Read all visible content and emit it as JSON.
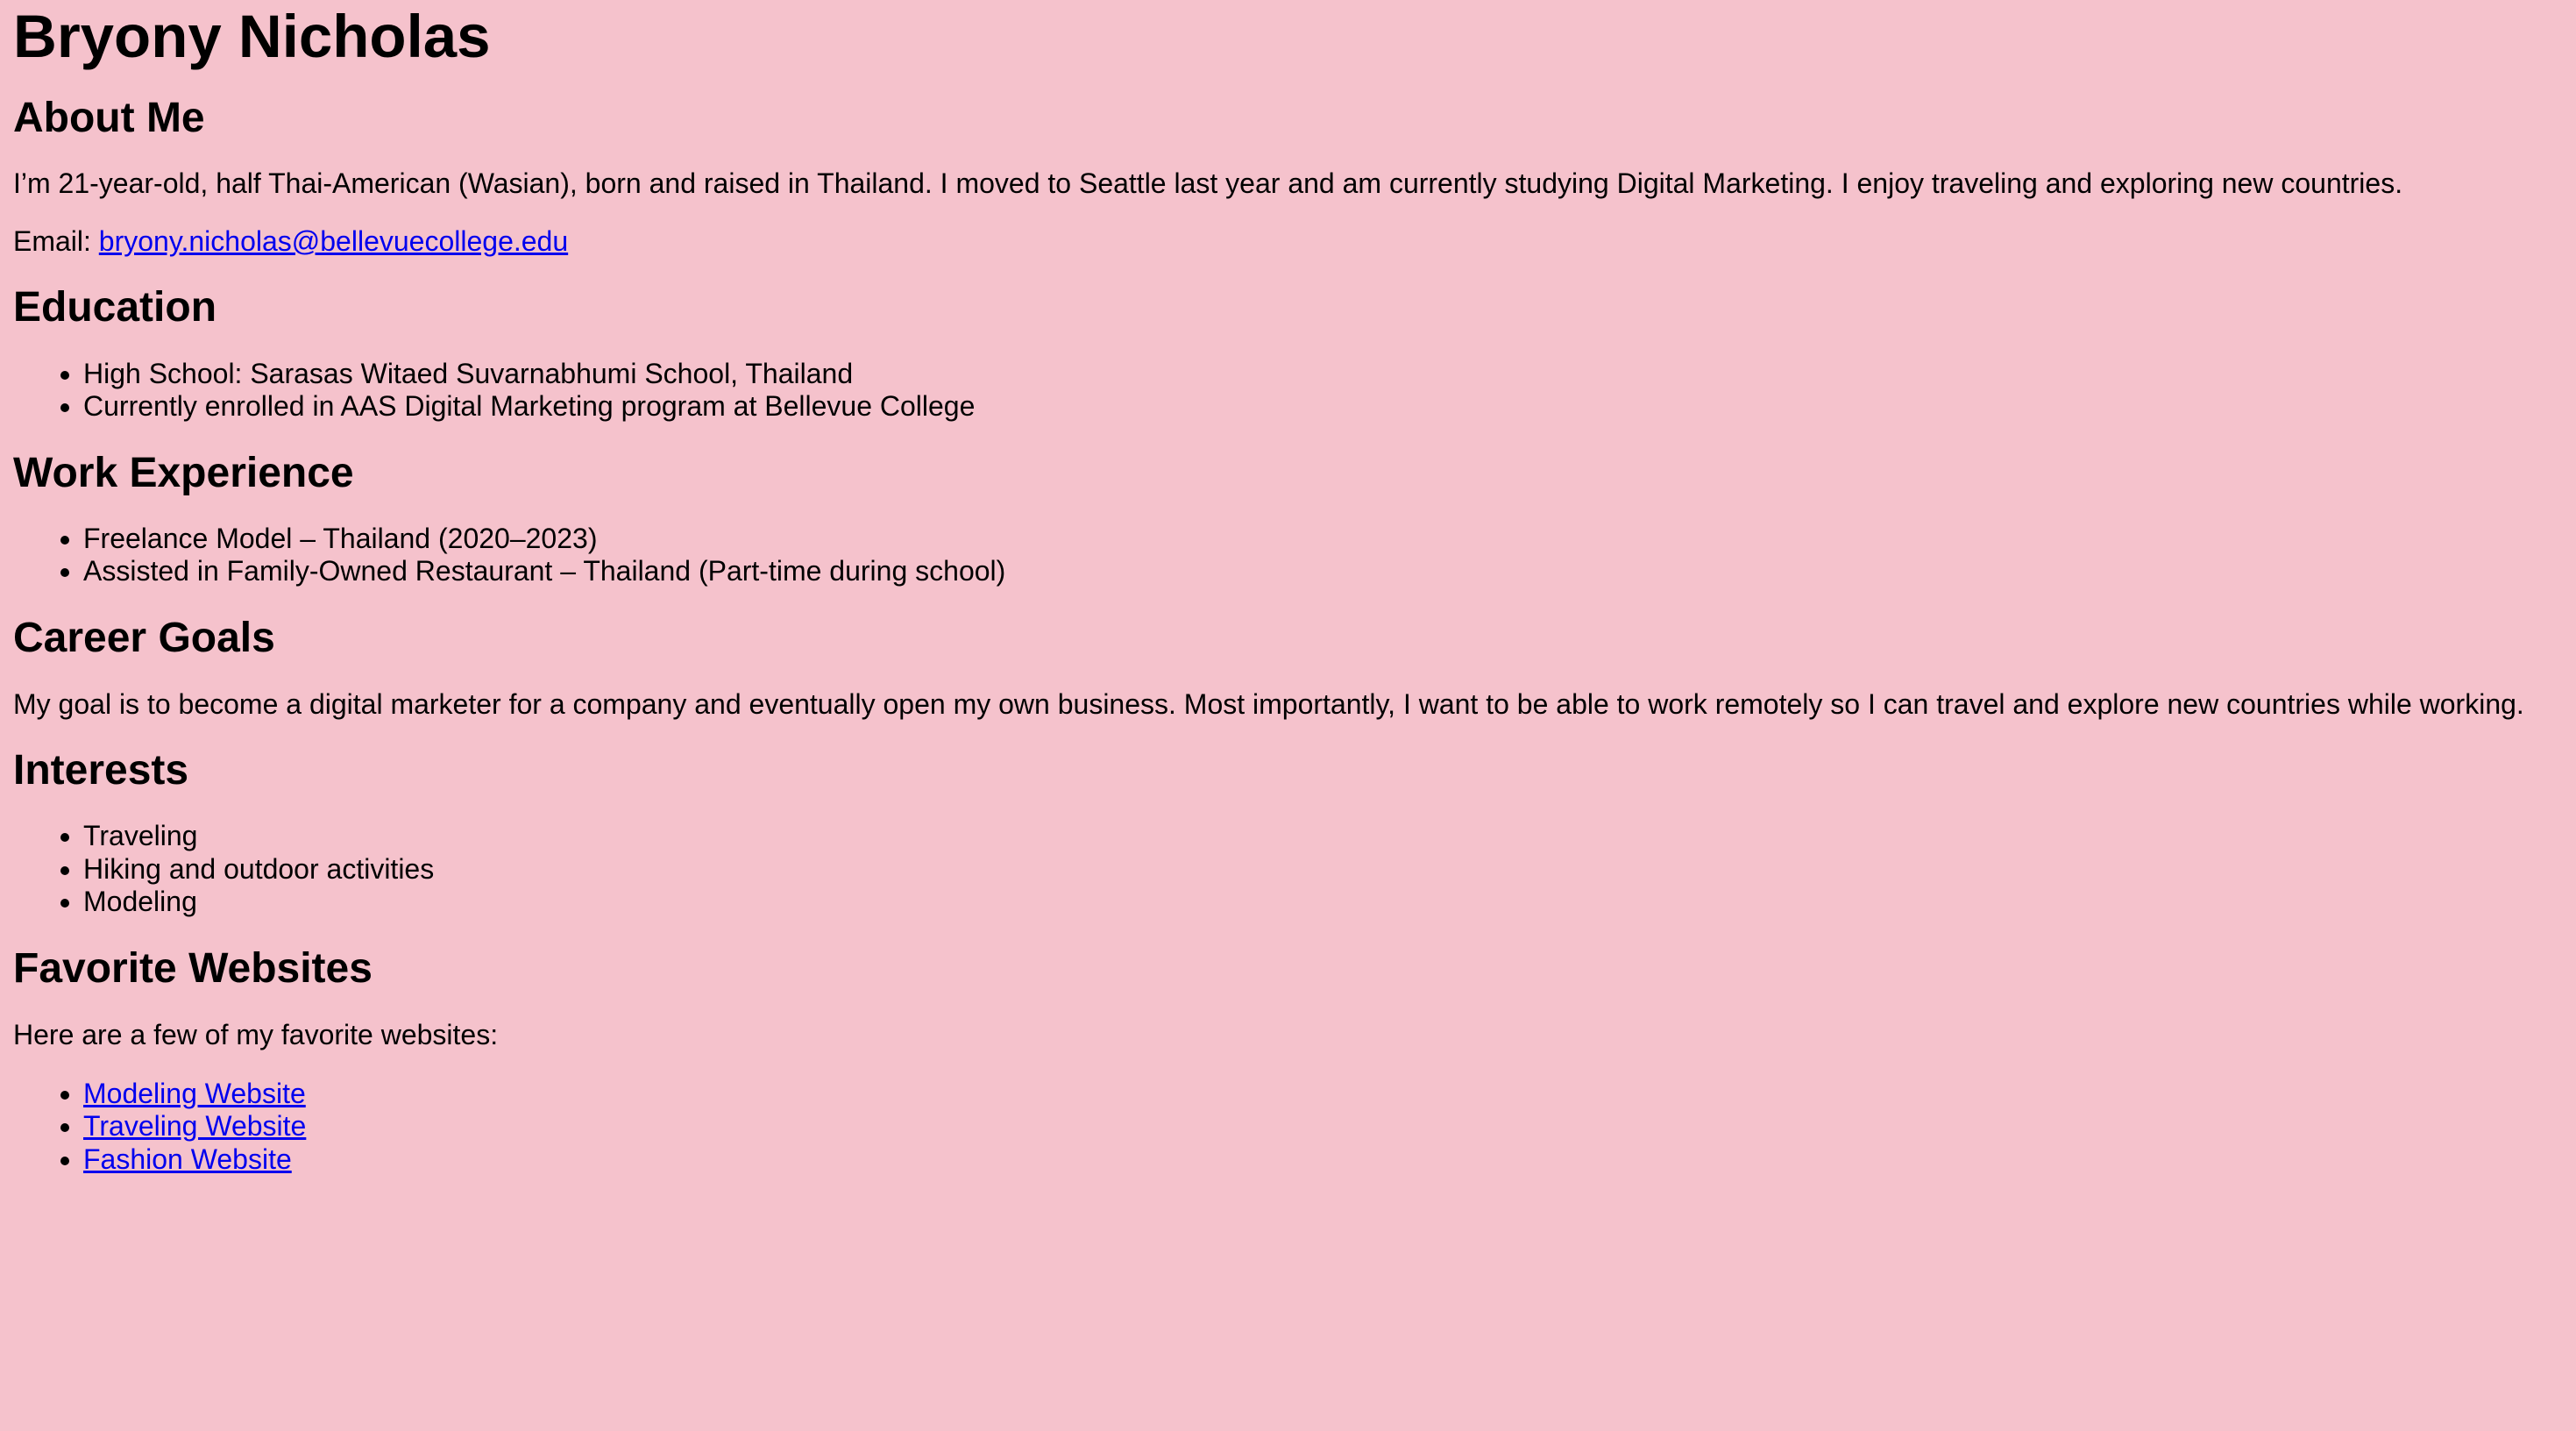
{
  "name": "Bryony Nicholas",
  "about": {
    "heading": "About Me",
    "text": "I’m 21-year-old, half Thai-American (Wasian), born and raised in Thailand. I moved to Seattle last year and am currently studying Digital Marketing. I enjoy traveling and exploring new countries.",
    "email_label": "Email:",
    "email": "bryony.nicholas@bellevuecollege.edu"
  },
  "education": {
    "heading": "Education",
    "items": [
      "High School: Sarasas Witaed Suvarnabhumi School, Thailand",
      "Currently enrolled in AAS Digital Marketing program at Bellevue College"
    ]
  },
  "work": {
    "heading": "Work Experience",
    "items": [
      "Freelance Model – Thailand (2020–2023)",
      "Assisted in Family-Owned Restaurant – Thailand (Part-time during school)"
    ]
  },
  "career": {
    "heading": "Career Goals",
    "text": "My goal is to become a digital marketer for a company and eventually open my own business. Most importantly, I want to be able to work remotely so I can travel and explore new countries while working."
  },
  "interests": {
    "heading": "Interests",
    "items": [
      "Traveling",
      "Hiking and outdoor activities",
      "Modeling"
    ]
  },
  "websites": {
    "heading": "Favorite Websites",
    "intro": "Here are a few of my favorite websites:",
    "links": [
      "Modeling Website",
      "Traveling Website",
      "Fashion Website"
    ]
  },
  "colors": {
    "background": "#f5c2cc",
    "link": "#0000ee",
    "text": "#000000"
  }
}
